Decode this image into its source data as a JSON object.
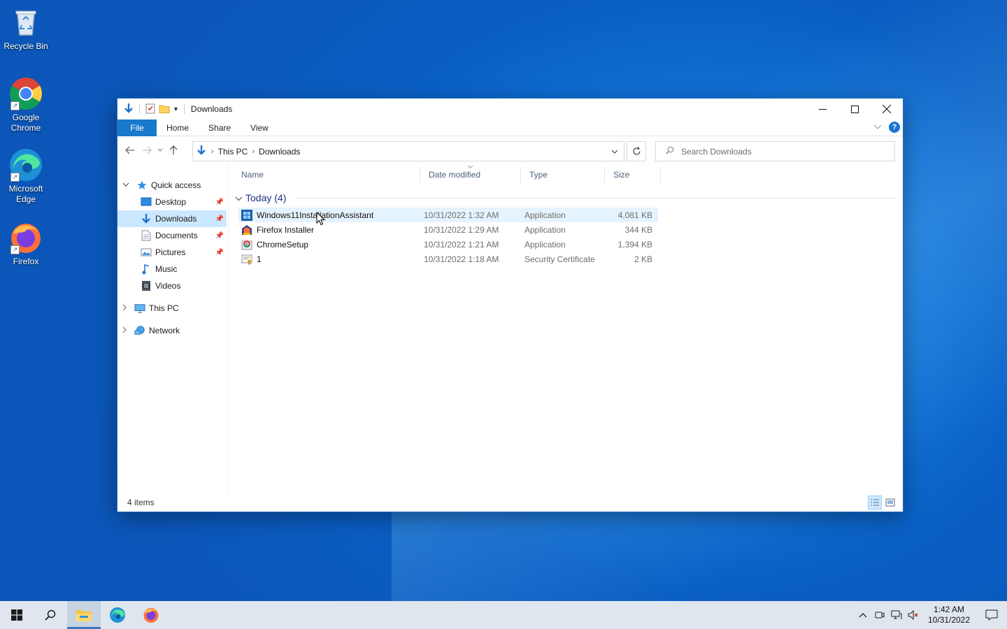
{
  "desktop": {
    "icons": [
      {
        "label": "Recycle Bin",
        "icon": "recycle-bin-icon"
      },
      {
        "label": "Google Chrome",
        "icon": "chrome-icon"
      },
      {
        "label": "Microsoft Edge",
        "icon": "edge-icon"
      },
      {
        "label": "Firefox",
        "icon": "firefox-icon"
      }
    ]
  },
  "window": {
    "title": "Downloads",
    "ribbon_tabs": [
      "File",
      "Home",
      "Share",
      "View"
    ],
    "help_label": "?",
    "address": {
      "crumbs": [
        "This PC",
        "Downloads"
      ]
    },
    "search": {
      "placeholder": "Search Downloads"
    },
    "nav": {
      "quick_access": "Quick access",
      "items": [
        {
          "label": "Desktop",
          "icon": "desktop-folder-icon",
          "pinned": true
        },
        {
          "label": "Downloads",
          "icon": "downloads-folder-icon",
          "pinned": true,
          "selected": true
        },
        {
          "label": "Documents",
          "icon": "documents-folder-icon",
          "pinned": true
        },
        {
          "label": "Pictures",
          "icon": "pictures-folder-icon",
          "pinned": true
        },
        {
          "label": "Music",
          "icon": "music-folder-icon",
          "pinned": false
        },
        {
          "label": "Videos",
          "icon": "videos-folder-icon",
          "pinned": false
        }
      ],
      "this_pc": "This PC",
      "network": "Network"
    },
    "columns": [
      "Name",
      "Date modified",
      "Type",
      "Size"
    ],
    "group": {
      "label": "Today (4)"
    },
    "files": [
      {
        "name": "Windows11InstallationAssistant",
        "date": "10/31/2022 1:32 AM",
        "type": "Application",
        "size": "4,081 KB",
        "icon": "windows-installer-icon"
      },
      {
        "name": "Firefox Installer",
        "date": "10/31/2022 1:29 AM",
        "type": "Application",
        "size": "344 KB",
        "icon": "firefox-installer-icon"
      },
      {
        "name": "ChromeSetup",
        "date": "10/31/2022 1:21 AM",
        "type": "Application",
        "size": "1,394 KB",
        "icon": "chrome-setup-icon"
      },
      {
        "name": "1",
        "date": "10/31/2022 1:18 AM",
        "type": "Security Certificate",
        "size": "2 KB",
        "icon": "certificate-icon"
      }
    ],
    "status": {
      "item_count": "4 items"
    }
  },
  "taskbar": {
    "clock_time": "1:42 AM",
    "clock_date": "10/31/2022"
  },
  "colors": {
    "accent": "#1979ca",
    "selection": "#cce8ff",
    "group_header": "#1e3287"
  }
}
